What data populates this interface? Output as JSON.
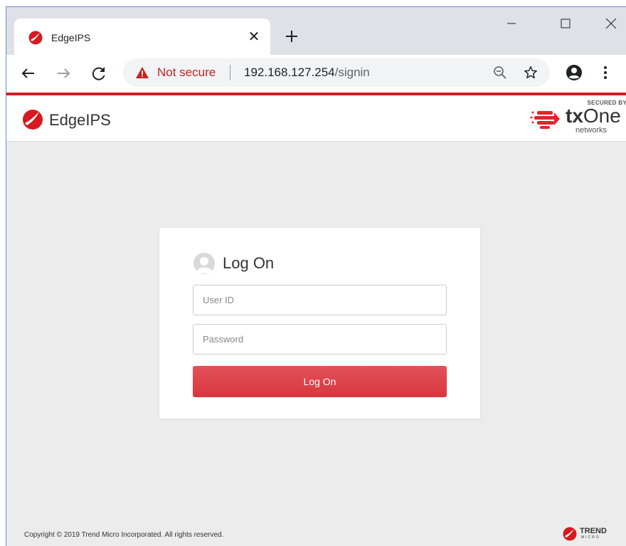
{
  "browser": {
    "tab_title": "EdgeIPS",
    "tab_close": "✕",
    "security_label": "Not secure",
    "url_host": "192.168.127.254",
    "url_path": "/signin"
  },
  "header": {
    "app_name": "EdgeIPS",
    "partner_secured_by": "SECURED BY",
    "partner_name_tx": "tx",
    "partner_name_one": "One",
    "partner_sub": "networks"
  },
  "login": {
    "title": "Log On",
    "user_placeholder": "User ID",
    "password_placeholder": "Password",
    "button_label": "Log On"
  },
  "footer": {
    "copyright": "Copyright © 2019 Trend Micro Incorporated. All rights reserved.",
    "vendor_top": "TREND",
    "vendor_bottom": "MICRO"
  },
  "colors": {
    "brand_red": "#d71920",
    "button_red": "#dc3d45",
    "warning_red": "#c5221f"
  },
  "icons": [
    "edgeips-logo-icon",
    "close-icon",
    "plus-icon",
    "minimize-icon",
    "maximize-icon",
    "back-arrow-icon",
    "forward-arrow-icon",
    "reload-icon",
    "warning-icon",
    "zoom-icon",
    "star-icon",
    "profile-icon",
    "more-vert-icon",
    "user-avatar-icon",
    "txone-logo-icon",
    "trend-micro-logo-icon"
  ]
}
